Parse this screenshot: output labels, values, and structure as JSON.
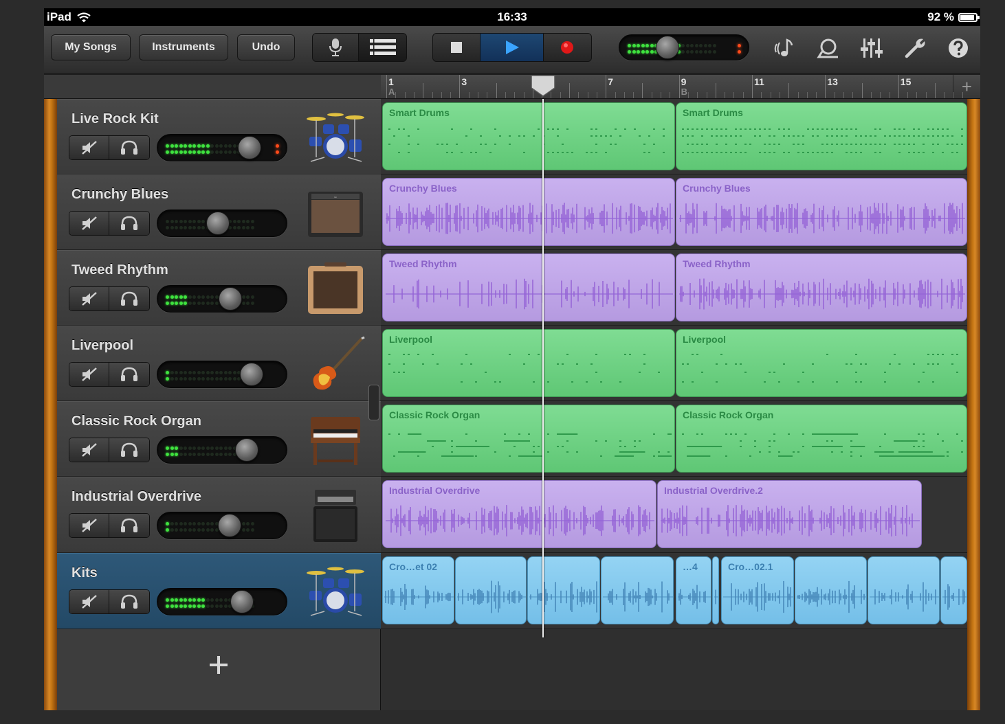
{
  "status_bar": {
    "device": "iPad",
    "time": "16:33",
    "battery": "92 %",
    "battery_level": 0.92
  },
  "toolbar": {
    "my_songs": "My Songs",
    "instruments": "Instruments",
    "undo": "Undo",
    "icons": [
      "microphone-icon",
      "tracks-view-icon",
      "stop-icon",
      "play-icon",
      "record-icon",
      "metronome-icon",
      "loop-icon",
      "mixer-icon",
      "settings-icon",
      "help-icon"
    ],
    "master_volume": 0.32
  },
  "ruler": {
    "bars": [
      "1",
      "3",
      "5",
      "7",
      "9",
      "11",
      "13",
      "15"
    ],
    "sections": [
      "A",
      "B"
    ],
    "add": "+"
  },
  "tracks": [
    {
      "name": "Live Rock Kit",
      "instrument": "drum-kit-icon",
      "volume": 0.78,
      "meter_leds": 10,
      "peak": true,
      "color": "green",
      "regions": [
        {
          "label": "Smart Drums",
          "color": "green"
        },
        {
          "label": "Smart Drums",
          "color": "green"
        }
      ]
    },
    {
      "name": "Crunchy Blues",
      "instrument": "amp-icon",
      "volume": 0.45,
      "meter_leds": 0,
      "peak": false,
      "color": "purple",
      "regions": [
        {
          "label": "Crunchy Blues",
          "color": "purple"
        },
        {
          "label": "Crunchy Blues",
          "color": "purple"
        }
      ]
    },
    {
      "name": "Tweed Rhythm",
      "instrument": "tweed-amp-icon",
      "volume": 0.58,
      "meter_leds": 5,
      "peak": false,
      "color": "purple",
      "regions": [
        {
          "label": "Tweed Rhythm",
          "color": "purple"
        },
        {
          "label": "Tweed Rhythm",
          "color": "purple"
        }
      ]
    },
    {
      "name": "Liverpool",
      "instrument": "bass-guitar-icon",
      "volume": 0.8,
      "meter_leds": 1,
      "peak": false,
      "color": "green",
      "regions": [
        {
          "label": "Liverpool",
          "color": "green"
        },
        {
          "label": "Liverpool",
          "color": "green"
        }
      ]
    },
    {
      "name": "Classic Rock Organ",
      "instrument": "organ-icon",
      "volume": 0.75,
      "meter_leds": 3,
      "peak": false,
      "color": "green",
      "regions": [
        {
          "label": "Classic Rock Organ",
          "color": "green"
        },
        {
          "label": "Classic Rock Organ",
          "color": "green"
        }
      ]
    },
    {
      "name": "Industrial Overdrive",
      "instrument": "amp-stack-icon",
      "volume": 0.57,
      "meter_leds": 1,
      "peak": false,
      "color": "purple",
      "regions": [
        {
          "label": "Industrial Overdrive",
          "color": "purple"
        },
        {
          "label": "Industrial Overdrive.2",
          "color": "purple"
        }
      ]
    },
    {
      "name": "Kits",
      "instrument": "drum-kit-icon",
      "volume": 0.7,
      "meter_leds": 9,
      "peak": false,
      "color": "blue",
      "selected": true,
      "regions": [
        {
          "label": "Cro…et 02",
          "color": "blue"
        },
        {
          "label": "",
          "color": "blue"
        },
        {
          "label": "",
          "color": "blue"
        },
        {
          "label": "",
          "color": "blue"
        },
        {
          "label": "…4",
          "color": "blue"
        },
        {
          "label": "",
          "color": "blue"
        },
        {
          "label": "Cro…02.1",
          "color": "blue"
        },
        {
          "label": "",
          "color": "blue"
        },
        {
          "label": "",
          "color": "blue"
        },
        {
          "label": "",
          "color": "blue"
        }
      ]
    }
  ],
  "add_track": "+",
  "colors": {
    "green": "#6fd183",
    "purple": "#c0a6e8",
    "blue": "#86c9ef",
    "selected_header": "#2a5272",
    "wood": "#c27412",
    "meter_led": "#3fe23f",
    "peak_led": "#ff4a1a"
  }
}
